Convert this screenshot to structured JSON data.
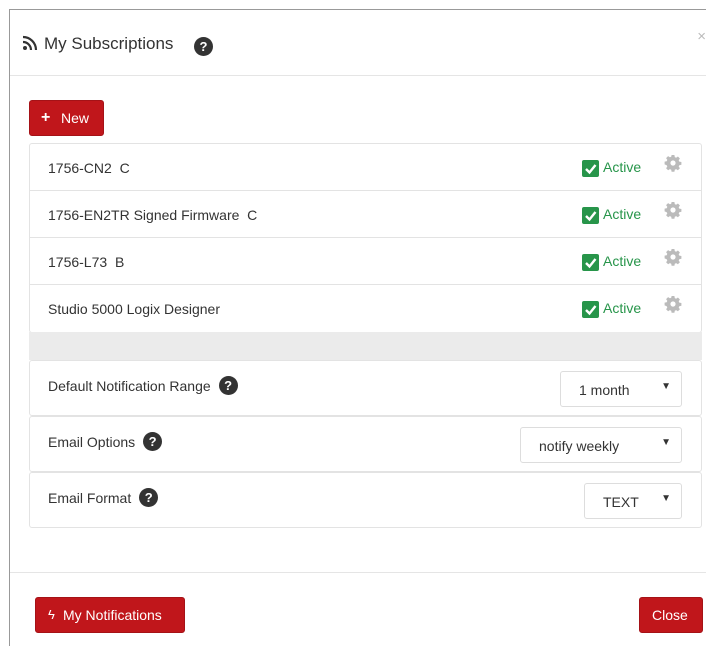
{
  "header": {
    "title": "My Subscriptions",
    "close": "×"
  },
  "actions": {
    "new_label": "New"
  },
  "subscriptions": [
    {
      "name": "1756-CN2  C",
      "status": "Active",
      "checked": true
    },
    {
      "name": "1756-EN2TR Signed Firmware  C",
      "status": "Active",
      "checked": true
    },
    {
      "name": "1756-L73  B",
      "status": "Active",
      "checked": true
    },
    {
      "name": "Studio 5000 Logix Designer",
      "status": "Active",
      "checked": true
    }
  ],
  "options": {
    "notification_range": {
      "label": "Default Notification Range",
      "value": "1 month"
    },
    "email_options": {
      "label": "Email Options",
      "value": "notify weekly"
    },
    "email_format": {
      "label": "Email Format",
      "value": "TEXT"
    }
  },
  "footer": {
    "notifications_label": "My Notifications",
    "close_label": "Close"
  },
  "colors": {
    "brand_red": "#c0161b",
    "active_green": "#27954a"
  }
}
